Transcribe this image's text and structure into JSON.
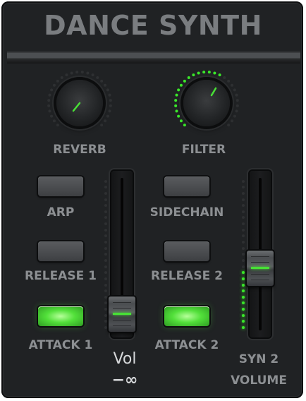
{
  "title": "DANCE SYNTH",
  "colors": {
    "accent_green": "#3ae82a",
    "label_grey": "#8c8f92",
    "panel_bg": "#202224"
  },
  "knobs": [
    {
      "label": "REVERB",
      "value": 0.1,
      "ring": "off"
    },
    {
      "label": "FILTER",
      "value": 0.62,
      "ring": "on"
    }
  ],
  "buttons": [
    {
      "label": "ARP",
      "state": "off"
    },
    {
      "label": "RELEASE 1",
      "state": "off"
    },
    {
      "label": "ATTACK 1",
      "state": "on"
    },
    {
      "label": "SIDECHAIN",
      "state": "off"
    },
    {
      "label": "RELEASE 2",
      "state": "off"
    },
    {
      "label": "ATTACK 2",
      "state": "on"
    }
  ],
  "faders": [
    {
      "name": "Vol",
      "readout": "−∞",
      "level": 0.0
    },
    {
      "label_line1": "SYN 2",
      "label_line2": "VOLUME",
      "level": 0.38
    }
  ]
}
